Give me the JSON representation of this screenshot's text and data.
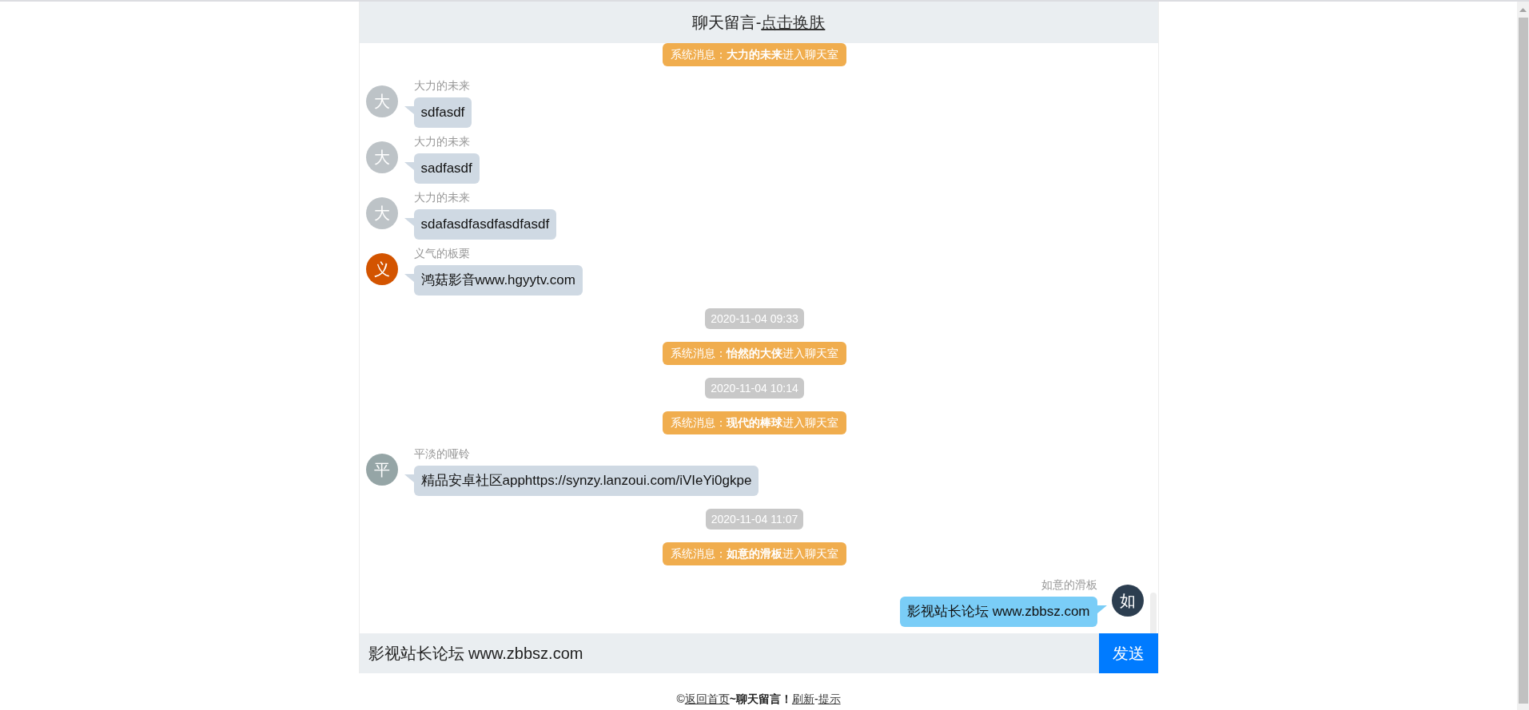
{
  "header": {
    "title": "聊天留言-",
    "link": "点击换肤"
  },
  "messages": [
    {
      "kind": "system",
      "text": "系统消息：**大力的未来**进入聊天室"
    },
    {
      "kind": "incoming",
      "avatar": "大",
      "color": "#bdc3c7",
      "name": "大力的未来",
      "text": "sdfasdf"
    },
    {
      "kind": "incoming",
      "avatar": "大",
      "color": "#bdc3c7",
      "name": "大力的未来",
      "text": "sadfasdf"
    },
    {
      "kind": "incoming",
      "avatar": "大",
      "color": "#bdc3c7",
      "name": "大力的未来",
      "text": "sdafasdfasdfasdfasdf"
    },
    {
      "kind": "incoming",
      "avatar": "义",
      "color": "#d35400",
      "name": "义气的板栗",
      "text": "鸿菇影音www.hgyytv.com"
    },
    {
      "kind": "time",
      "text": "2020-11-04 09:33"
    },
    {
      "kind": "system",
      "text": "系统消息：**怡然的大侠**进入聊天室"
    },
    {
      "kind": "time",
      "text": "2020-11-04 10:14"
    },
    {
      "kind": "system",
      "text": "系统消息：**现代的棒球**进入聊天室"
    },
    {
      "kind": "incoming",
      "avatar": "平",
      "color": "#95a5a6",
      "name": "平淡的哑铃",
      "text": "精品安卓社区apphttps://synzy.lanzoui.com/iVIeYi0gkpe"
    },
    {
      "kind": "time",
      "text": "2020-11-04 11:07"
    },
    {
      "kind": "system",
      "text": "系统消息：**如意的滑板**进入聊天室"
    },
    {
      "kind": "outgoing",
      "avatar": "如",
      "color": "#2c3e50",
      "name": "如意的滑板",
      "text": "影视站长论坛 www.zbbsz.com"
    }
  ],
  "composer": {
    "value": "影视站长论坛 www.zbbsz.com",
    "button": "发送"
  },
  "footer": [
    {
      "kind": "text",
      "text": "©"
    },
    {
      "kind": "link",
      "text": "返回首页"
    },
    {
      "kind": "text",
      "text": "**~聊天留言！**"
    },
    {
      "kind": "link",
      "text": "刷新"
    },
    {
      "kind": "text",
      "text": "-"
    },
    {
      "kind": "link",
      "text": "提示"
    }
  ]
}
